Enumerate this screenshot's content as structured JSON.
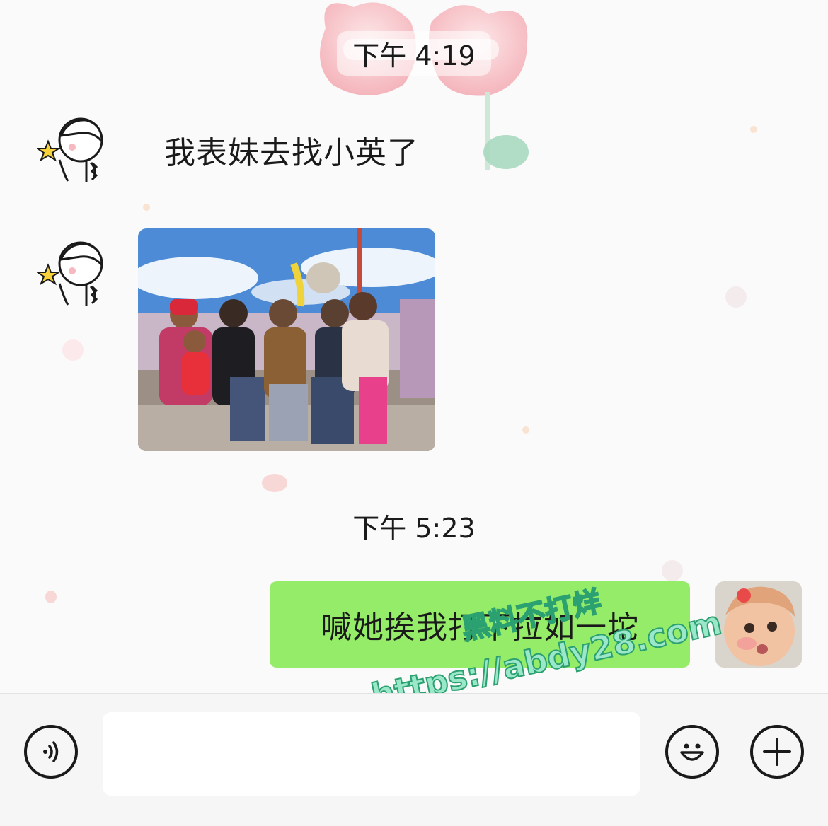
{
  "timestamps": [
    "下午 4:19",
    "下午 5:23"
  ],
  "messages": {
    "incoming_text": "我表妹去找小英了",
    "outgoing_text": "喊她挨我打下拉如一坨"
  },
  "watermark": {
    "line1": "黑料不打烊",
    "line2": "https://abdy28.com"
  },
  "icons": {
    "voice": "voice-icon",
    "emoji": "emoji-icon",
    "add": "plus-icon"
  },
  "colors": {
    "outgoing_bubble": "#95ec69",
    "background": "#fbfafa"
  }
}
